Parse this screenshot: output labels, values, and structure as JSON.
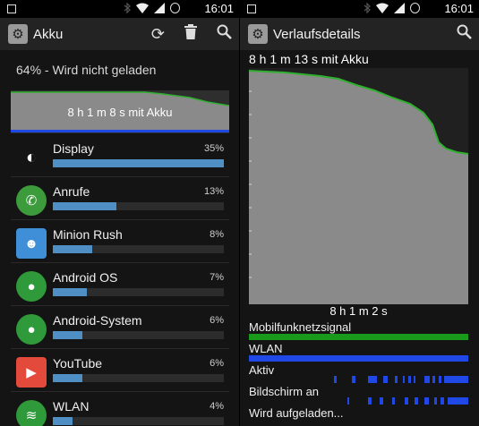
{
  "left": {
    "status_bar": {
      "time": "16:01"
    },
    "appbar": {
      "title": "Akku",
      "actions": [
        "refresh-icon",
        "delete-icon",
        "search-icon"
      ]
    },
    "battery_status": "64% - Wird nicht geladen",
    "summary": "8 h 1 m 8 s mit Akku",
    "apps": [
      {
        "name": "Display",
        "percent": "35%",
        "share": 0.35,
        "icon": "display-icon",
        "icon_color": "#111111"
      },
      {
        "name": "Anrufe",
        "percent": "13%",
        "share": 0.13,
        "icon": "phone-icon",
        "icon_color": "#3c9b3a"
      },
      {
        "name": "Minion Rush",
        "percent": "8%",
        "share": 0.08,
        "icon": "minion-icon",
        "icon_color": "#3f8fd8"
      },
      {
        "name": "Android OS",
        "percent": "7%",
        "share": 0.07,
        "icon": "android-os-icon",
        "icon_color": "#2f9a3a"
      },
      {
        "name": "Android-System",
        "percent": "6%",
        "share": 0.06,
        "icon": "android-system-icon",
        "icon_color": "#2f9a3a"
      },
      {
        "name": "YouTube",
        "percent": "6%",
        "share": 0.06,
        "icon": "youtube-icon",
        "icon_color": "#e34a3c"
      },
      {
        "name": "WLAN",
        "percent": "4%",
        "share": 0.04,
        "icon": "wifi-icon",
        "icon_color": "#2f9a3a"
      }
    ]
  },
  "right": {
    "status_bar": {
      "time": "16:01"
    },
    "appbar": {
      "title": "Verlaufsdetails",
      "actions": [
        "search-icon"
      ]
    },
    "history_title": "8 h 1 m 13 s mit Akku",
    "duration": "8 h 1 m 2 s",
    "signals": [
      {
        "label": "Mobilfunknetzsignal",
        "color": "#1a9a1a"
      },
      {
        "label": "WLAN",
        "color": "#1f48e6"
      },
      {
        "label": "Aktiv",
        "color": "#1f48e6"
      },
      {
        "label": "Bildschirm an",
        "color": "#1f48e6"
      },
      {
        "label": "Wird aufgeladen...",
        "color": ""
      }
    ]
  },
  "colors": {
    "bar": "#4f8fc3",
    "graph_line": "#2fb02f",
    "graph_fill": "#8a8a8a"
  }
}
